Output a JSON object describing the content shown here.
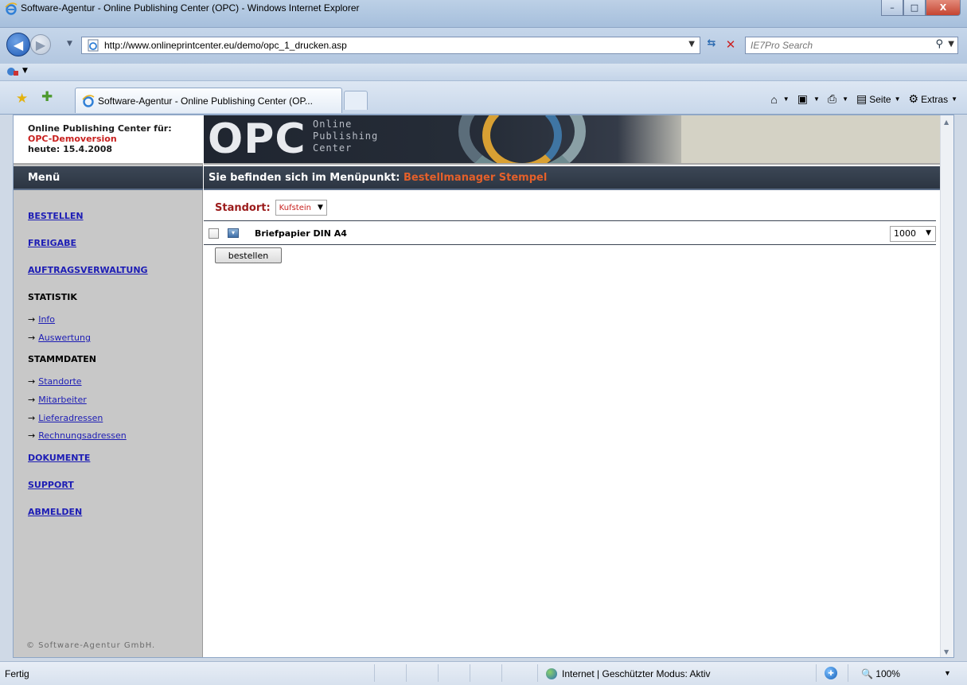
{
  "window": {
    "title": "Software-Agentur - Online Publishing Center (OPC) - Windows Internet Explorer",
    "minimize": "–",
    "maximize": "□",
    "close": "X"
  },
  "address": {
    "url": "http://www.onlineprintcenter.eu/demo/opc_1_drucken.asp",
    "search_placeholder": "IE7Pro Search"
  },
  "tabs": [
    {
      "label": "Software-Agentur - Online Publishing Center (OP..."
    }
  ],
  "commandbar": {
    "page_label": "Seite",
    "tools_label": "Extras"
  },
  "page": {
    "brand": {
      "line1": "Online Publishing Center für:",
      "line2": "OPC-Demoversion",
      "line3": "heute: 15.4.2008"
    },
    "banner": {
      "logo": "OPC",
      "tagline1": "Online",
      "tagline2": "Publishing",
      "tagline3": "Center"
    },
    "menu_header": "Menü",
    "breadcrumb": {
      "prefix": "Sie befinden sich im Menüpunkt:",
      "current": "Bestellmanager Stempel"
    },
    "menu": {
      "bestellen": "BESTELLEN",
      "freigabe": "FREIGABE",
      "auftrag": "AUFTRAGSVERWALTUNG",
      "statistik": "STATISTIK",
      "info": "Info",
      "auswertung": "Auswertung",
      "stammdaten": "STAMMDATEN",
      "standorte": "Standorte",
      "mitarbeiter": "Mitarbeiter",
      "lieferadressen": "Lieferadressen",
      "rechnungsadressen": "Rechnungsadressen",
      "dokumente": "DOKUMENTE",
      "support": "SUPPORT",
      "abmelden": "ABMELDEN",
      "arrow": "→"
    },
    "copyright": "© Software-Agentur GmbH.",
    "standort": {
      "label": "Standort:",
      "selected": "Kufstein"
    },
    "product": {
      "name": "Briefpapier DIN A4",
      "quantity": "1000"
    },
    "order_button": "bestellen"
  },
  "status": {
    "text": "Fertig",
    "zone": "Internet | Geschützter Modus: Aktiv",
    "zoom": "100%"
  }
}
